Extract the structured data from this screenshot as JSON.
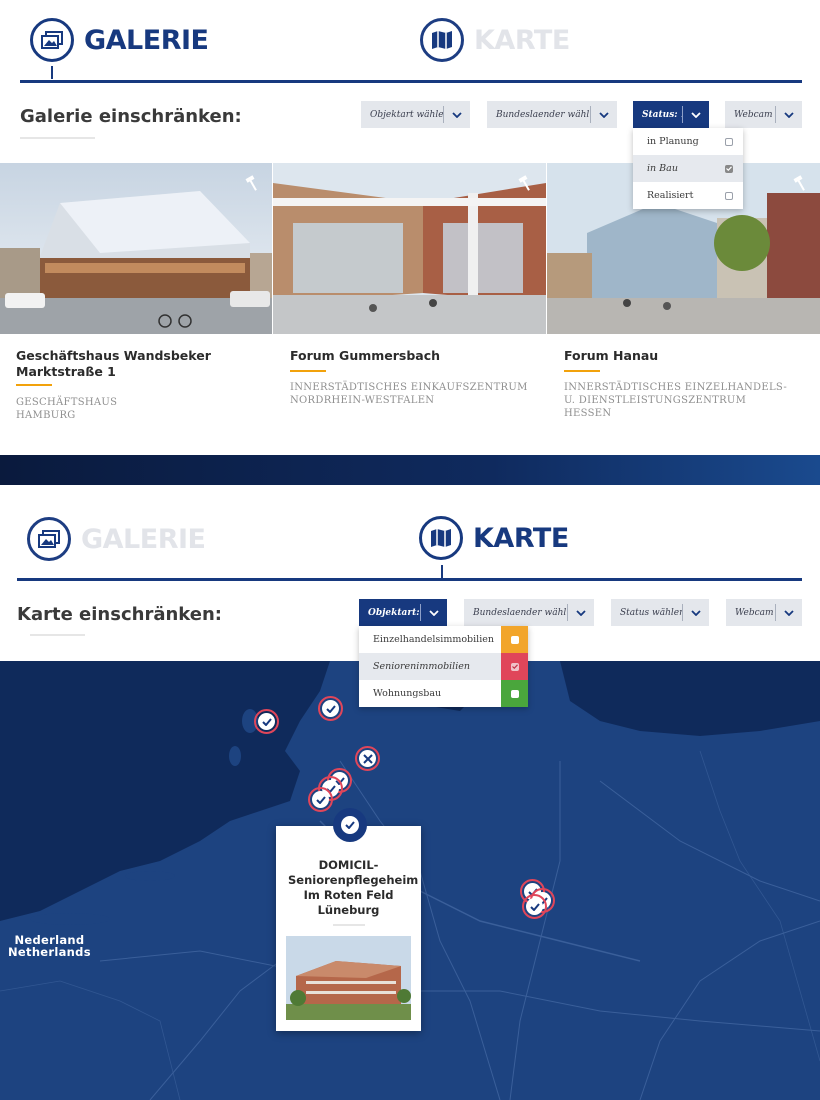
{
  "view_switch_top": {
    "galerie_label": "GALERIE",
    "karte_label": "KARTE",
    "active": "galerie"
  },
  "gallery_filter": {
    "heading": "Galerie einschränken:",
    "dropdowns": [
      {
        "label": "Objektart wählen"
      },
      {
        "label": "Bundeslaender wähl..."
      },
      {
        "label": "Status: 1"
      },
      {
        "label": "Webcam"
      }
    ],
    "status_menu": [
      {
        "label": "in Planung",
        "checked": false
      },
      {
        "label": "in Bau",
        "checked": true
      },
      {
        "label": "Realisiert",
        "checked": false
      }
    ]
  },
  "gallery_cards": [
    {
      "title": "Geschäftshaus Wandsbeker Marktstraße 1",
      "type": "GESCHÄFTSHAUS",
      "region": "HAMBURG"
    },
    {
      "title": "Forum Gummersbach",
      "type": "INNERSTÄDTISCHES EINKAUFSZENTRUM",
      "region": "NORDRHEIN-WESTFALEN"
    },
    {
      "title": "Forum Hanau",
      "type": "INNERSTÄDTISCHES EINZELHANDELS- U. DIENSTLEISTUNGSZENTRUM",
      "region": "HESSEN"
    }
  ],
  "view_switch_bottom": {
    "galerie_label": "GALERIE",
    "karte_label": "KARTE",
    "active": "karte"
  },
  "map_filter": {
    "heading": "Karte einschränken:",
    "dropdowns": [
      {
        "label": "Objektart: 1"
      },
      {
        "label": "Bundeslaender wähl..."
      },
      {
        "label": "Status wählen"
      },
      {
        "label": "Webcam"
      }
    ],
    "objektart_menu": [
      {
        "label": "Einzelhandelsimmobilien",
        "color": "#f2a52b",
        "checked": false
      },
      {
        "label": "Seniorenimmobilien",
        "color": "#e0465a",
        "checked": true
      },
      {
        "label": "Wohnungsbau",
        "color": "#4aa63c",
        "checked": false
      }
    ]
  },
  "map": {
    "country_label": "Nederland\nNetherlands",
    "country_label_line1": "Nederland",
    "country_label_line2": "Netherlands",
    "popup": {
      "title": "DOMICIL-Seniorenpflegeheim Im Roten Feld Lüneburg"
    }
  },
  "colors": {
    "brand": "#17397f",
    "accent": "#f2a20c",
    "map_bg": "#1d4380",
    "pin": "#e0465a"
  }
}
